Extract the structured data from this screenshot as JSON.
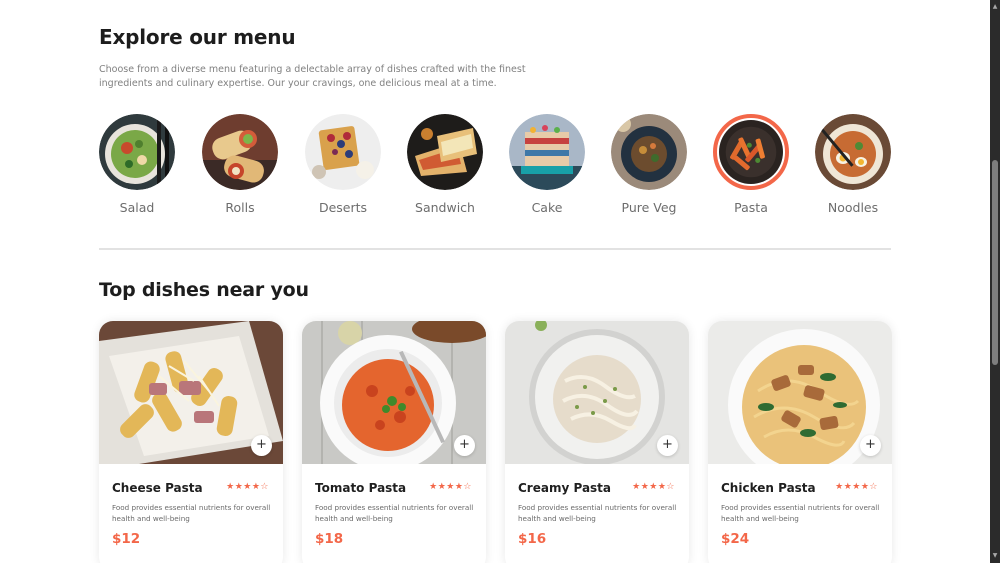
{
  "explore": {
    "title": "Explore our menu",
    "description": "Choose from a diverse menu featuring a delectable array of dishes crafted with the finest ingredients and culinary expertise. Our your cravings, one delicious meal at a time."
  },
  "menu": [
    {
      "label": "Salad",
      "icon": "salad-image",
      "active": false
    },
    {
      "label": "Rolls",
      "icon": "rolls-image",
      "active": false
    },
    {
      "label": "Deserts",
      "icon": "deserts-image",
      "active": false
    },
    {
      "label": "Sandwich",
      "icon": "sandwich-image",
      "active": false
    },
    {
      "label": "Cake",
      "icon": "cake-image",
      "active": false
    },
    {
      "label": "Pure Veg",
      "icon": "pure-veg-image",
      "active": false
    },
    {
      "label": "Pasta",
      "icon": "pasta-image",
      "active": true
    },
    {
      "label": "Noodles",
      "icon": "noodles-image",
      "active": false
    }
  ],
  "top_dishes": {
    "title": "Top dishes near you",
    "items": [
      {
        "name": "Cheese Pasta",
        "rating": "★★★★☆",
        "description": "Food provides essential nutrients for overall health and well-being",
        "price": "$12",
        "add_label": "+"
      },
      {
        "name": "Tomato Pasta",
        "rating": "★★★★☆",
        "description": "Food provides essential nutrients for overall health and well-being",
        "price": "$18",
        "add_label": "+"
      },
      {
        "name": "Creamy Pasta",
        "rating": "★★★★☆",
        "description": "Food provides essential nutrients for overall health and well-being",
        "price": "$16",
        "add_label": "+"
      },
      {
        "name": "Chicken Pasta",
        "rating": "★★★★☆",
        "description": "Food provides essential nutrients for overall health and well-being",
        "price": "$24",
        "add_label": "+"
      }
    ]
  },
  "colors": {
    "accent": "#f36749",
    "heading": "#1d1d1d",
    "muted": "#808080"
  }
}
